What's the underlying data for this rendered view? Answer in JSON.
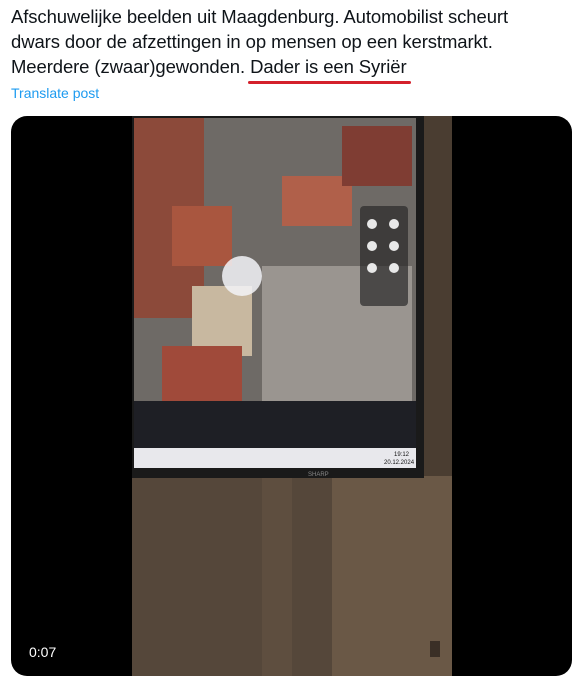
{
  "tweet": {
    "text_line1": "Afschuwelijke beelden uit Maagdenburg. Automobilist scheurt",
    "text_line2": "dwars door de afzettingen in op mensen op een kerstmarkt.",
    "text_line3_prefix": "Meerdere (zwaar)gewonden. ",
    "text_line3_highlight": "Dader is een Syriër",
    "highlight_color": "#d4202b"
  },
  "translate_label": "Translate post",
  "media": {
    "duration": "0:07",
    "screen_clock": "19:12",
    "screen_date": "20.12.2024",
    "monitor_brand": "SHARP"
  },
  "colors": {
    "link": "#1d9bf0",
    "text": "#0f1419"
  }
}
